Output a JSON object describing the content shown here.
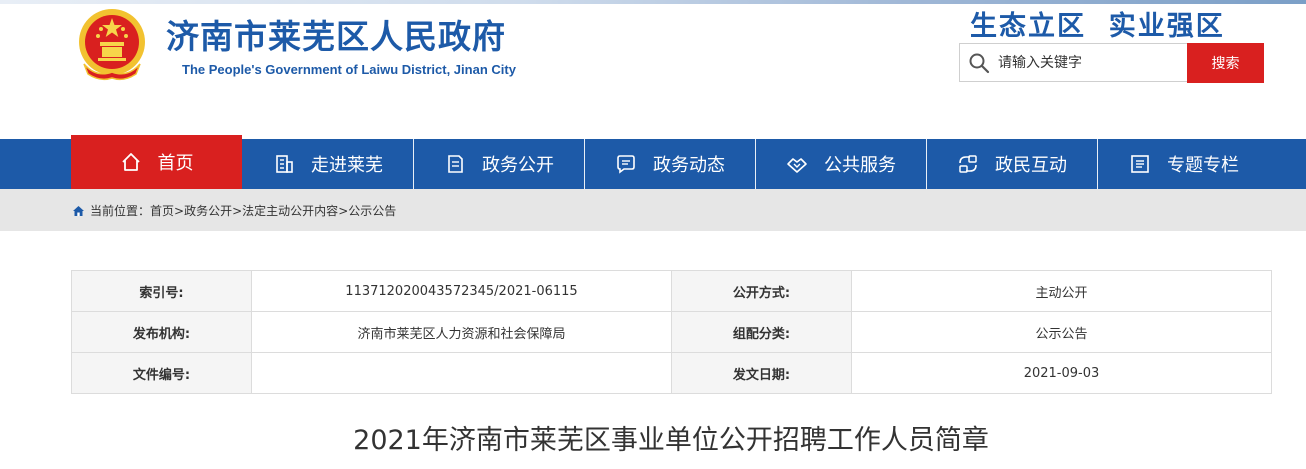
{
  "header": {
    "site_title": "济南市莱芜区人民政府",
    "site_subtitle": "The People's Government of Laiwu District, Jinan City",
    "slogan": "生态立区  实业强区",
    "search": {
      "placeholder": "请输入关键字",
      "button_label": "搜索"
    }
  },
  "colors": {
    "brand_blue": "#1d5aa8",
    "accent_red": "#d9201f",
    "crumb_bg": "#e6e6e6"
  },
  "nav": {
    "items": [
      {
        "label": "首页",
        "icon": "home-icon",
        "active": true
      },
      {
        "label": "走进莱芜",
        "icon": "building-icon"
      },
      {
        "label": "政务公开",
        "icon": "document-icon"
      },
      {
        "label": "政务动态",
        "icon": "chat-icon"
      },
      {
        "label": "公共服务",
        "icon": "handshake-icon"
      },
      {
        "label": "政民互动",
        "icon": "interaction-icon"
      },
      {
        "label": "专题专栏",
        "icon": "list-icon"
      }
    ]
  },
  "breadcrumb": {
    "prefix": "当前位置：",
    "items": [
      "首页",
      "政务公开",
      "法定主动公开内容",
      "公示公告"
    ],
    "separator": "> "
  },
  "meta_table": {
    "rows": [
      {
        "label1": "索引号:",
        "value1": "113712020043572345/2021-06115",
        "label2": "公开方式:",
        "value2": "主动公开"
      },
      {
        "label1": "发布机构:",
        "value1": "济南市莱芜区人力资源和社会保障局",
        "label2": "组配分类:",
        "value2": "公示公告"
      },
      {
        "label1": "文件编号:",
        "value1": "",
        "label2": "发文日期:",
        "value2": "2021-09-03"
      }
    ]
  },
  "article": {
    "title": "2021年济南市莱芜区事业单位公开招聘工作人员简章"
  }
}
